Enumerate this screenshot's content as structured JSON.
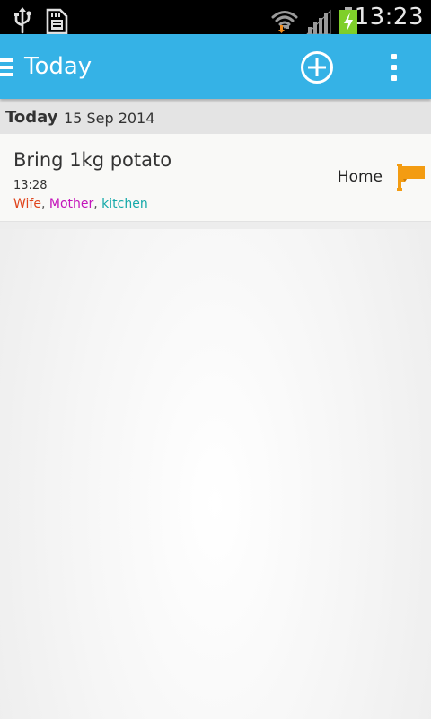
{
  "status_bar": {
    "time": "13:23",
    "icons": [
      "usb-icon",
      "sd-card-icon",
      "wifi-icon",
      "signal-icon",
      "battery-charging-icon"
    ]
  },
  "action_bar": {
    "title": "Today",
    "background_color": "#35b2e6",
    "actions": [
      "add-icon",
      "overflow-menu-icon"
    ]
  },
  "section": {
    "title": "Today",
    "date": "15 Sep 2014"
  },
  "tasks": [
    {
      "title": "Bring 1kg potato",
      "time": "13:28",
      "tags": [
        {
          "label": "Wife",
          "color": "#e0441b"
        },
        {
          "label": "Mother",
          "color": "#c314ba"
        },
        {
          "label": "kitchen",
          "color": "#14a9a9"
        }
      ],
      "tag_separator": ", ",
      "location": "Home",
      "flag_color": "#f39c12",
      "flag_icon": "flag-icon"
    }
  ]
}
